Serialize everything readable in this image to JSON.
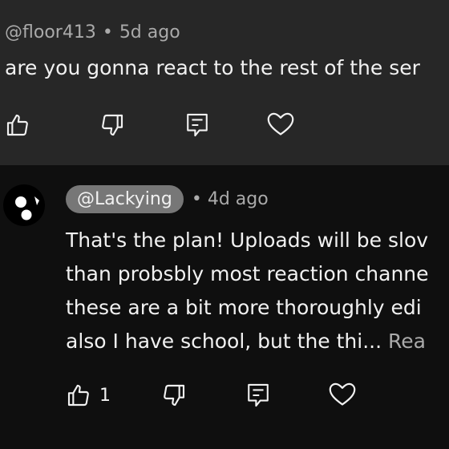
{
  "comment": {
    "author": "@floor413",
    "separator": "•",
    "time": "5d ago",
    "text": "are you gonna react to the rest of the ser",
    "actions": {
      "like_icon": "thumbs-up-icon",
      "dislike_icon": "thumbs-down-icon",
      "reply_icon": "reply-icon",
      "heart_icon": "heart-icon"
    }
  },
  "reply": {
    "author": "@Lackying",
    "separator": "•",
    "time": "4d ago",
    "lines": [
      "That's the plan! Uploads will be slov",
      "than probsbly most reaction channe",
      "these are a bit more thoroughly edi",
      "also I have school, but the thi..."
    ],
    "read_more": " Rea",
    "like_count": "1"
  },
  "colors": {
    "top_background": "#272727",
    "page_background": "#0f0f0f",
    "pill_background": "#777777",
    "secondary_text": "#aaaaaa"
  }
}
